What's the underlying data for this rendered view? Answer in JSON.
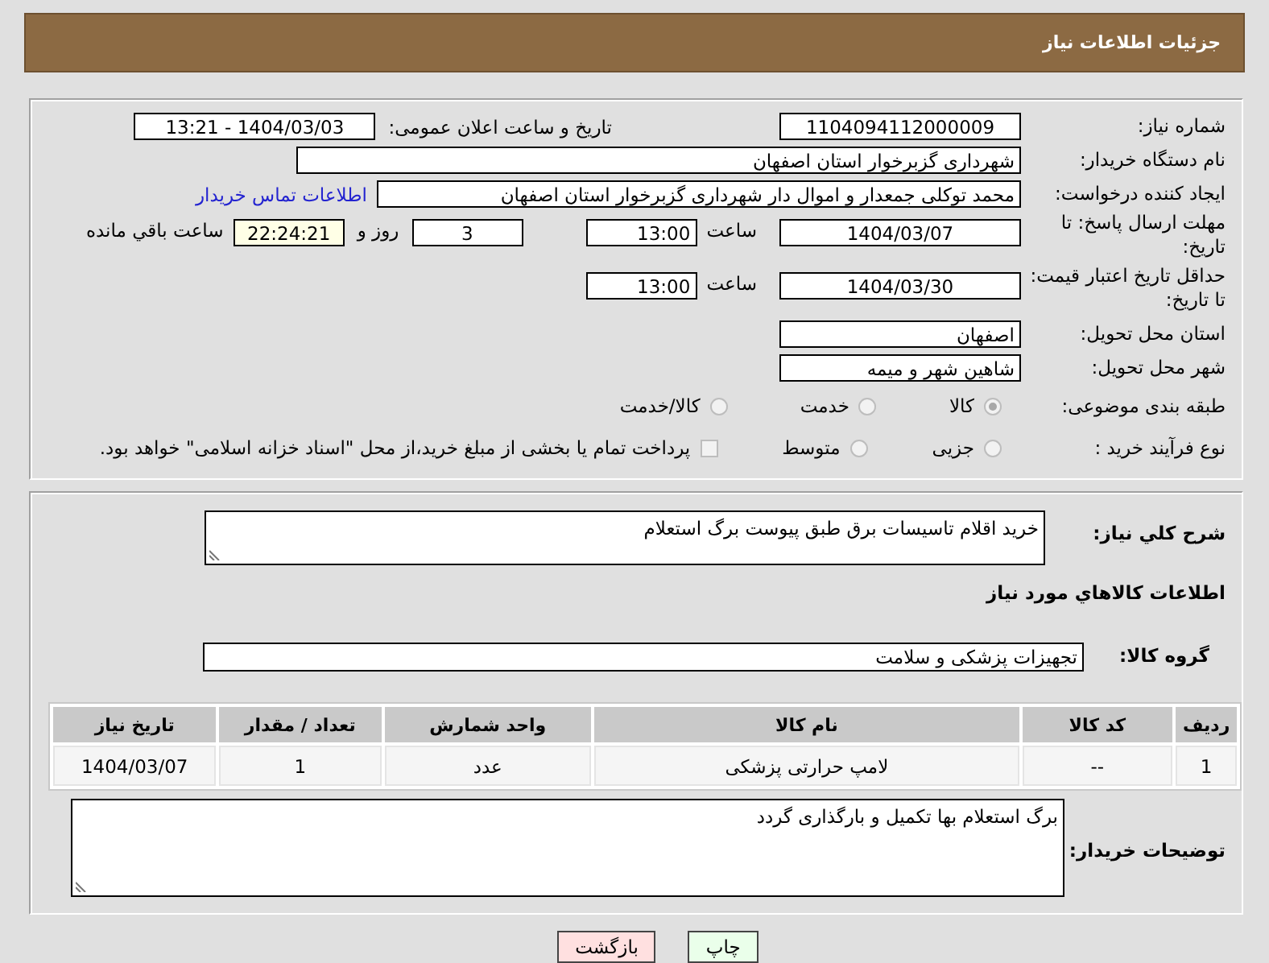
{
  "header": {
    "title": "جزئیات اطلاعات نیاز"
  },
  "need_number": {
    "label": "شماره نیاز:",
    "value": "1104094112000009"
  },
  "announce": {
    "label": "تاریخ و ساعت اعلان عمومی:",
    "value": "1404/03/03 - 13:21"
  },
  "buyer": {
    "label": "نام دستگاه خریدار:",
    "value": "شهرداری گزبرخوار استان اصفهان"
  },
  "creator": {
    "label": "ایجاد کننده درخواست:",
    "value": "محمد توکلی جمعدار و اموال دار شهرداری گزبرخوار استان اصفهان",
    "link": "اطلاعات تماس خریدار"
  },
  "deadline": {
    "label": "مهلت ارسال پاسخ: تا تاریخ:",
    "date": "1404/03/07",
    "time_label": "ساعت",
    "time": "13:00",
    "days": "3",
    "days_label": "روز و",
    "remaining": "22:24:21",
    "remaining_label": "ساعت باقي مانده"
  },
  "validity": {
    "label": "حداقل تاریخ اعتبار قیمت: تا تاریخ:",
    "date": "1404/03/30",
    "time_label": "ساعت",
    "time": "13:00"
  },
  "province": {
    "label": "استان محل تحویل:",
    "value": "اصفهان"
  },
  "city": {
    "label": "شهر محل تحویل:",
    "value": "شاهین شهر و میمه"
  },
  "category": {
    "label": "طبقه بندی موضوعی:",
    "options": [
      {
        "label": "کالا",
        "selected": true
      },
      {
        "label": "خدمت",
        "selected": false
      },
      {
        "label": "کالا/خدمت",
        "selected": false
      }
    ]
  },
  "process": {
    "label": "نوع فرآیند خرید :",
    "options": [
      {
        "label": "جزیی",
        "selected": false
      },
      {
        "label": "متوسط",
        "selected": false
      }
    ],
    "treasury": {
      "label": "پرداخت تمام یا بخشی از مبلغ خرید،از محل \"اسناد خزانه اسلامی\" خواهد بود.",
      "checked": false
    }
  },
  "description": {
    "label": "شرح کلي نیاز:",
    "value": "خرید اقلام تاسیسات برق طبق پیوست برگ استعلام"
  },
  "goods_heading": "اطلاعات کالاهاي مورد نیاز",
  "goods_group": {
    "label": "گروه کالا:",
    "value": "تجهیزات پزشکی و سلامت"
  },
  "table": {
    "columns": [
      "ردیف",
      "کد کالا",
      "نام کالا",
      "واحد شمارش",
      "تعداد / مقدار",
      "تاریخ نیاز"
    ],
    "rows": [
      [
        "1",
        "--",
        "لامپ حرارتی پزشکی",
        "عدد",
        "1",
        "1404/03/07"
      ]
    ]
  },
  "buyer_notes": {
    "label": "توضیحات خریدار:",
    "value": "برگ استعلام بها تکمیل و بارگذاری گردد"
  },
  "buttons": [
    {
      "label": "چاپ",
      "kind": "print"
    },
    {
      "label": "بازگشت",
      "kind": "back"
    }
  ]
}
